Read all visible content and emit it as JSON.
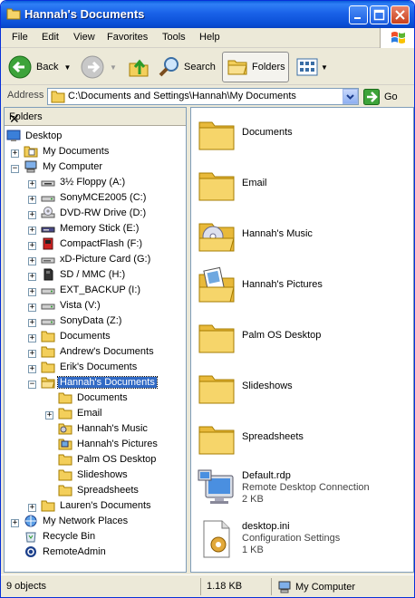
{
  "window": {
    "title": "Hannah's Documents"
  },
  "menubar": [
    "File",
    "Edit",
    "View",
    "Favorites",
    "Tools",
    "Help"
  ],
  "toolbar": {
    "back": "Back",
    "search": "Search",
    "folders": "Folders"
  },
  "address": {
    "label": "Address",
    "value": "C:\\Documents and Settings\\Hannah\\My Documents",
    "go": "Go"
  },
  "folders_pane": {
    "title": "Folders",
    "close": "✕"
  },
  "tree": [
    {
      "label": "Desktop"
    },
    {
      "label": "My Documents"
    },
    {
      "label": "My Computer"
    },
    {
      "label": "3½ Floppy (A:)"
    },
    {
      "label": "SonyMCE2005 (C:)"
    },
    {
      "label": "DVD-RW Drive (D:)"
    },
    {
      "label": "Memory Stick (E:)"
    },
    {
      "label": "CompactFlash (F:)"
    },
    {
      "label": "xD-Picture Card (G:)"
    },
    {
      "label": "SD / MMC (H:)"
    },
    {
      "label": "EXT_BACKUP (I:)"
    },
    {
      "label": "Vista (V:)"
    },
    {
      "label": "SonyData (Z:)"
    },
    {
      "label": "Documents"
    },
    {
      "label": "Andrew's Documents"
    },
    {
      "label": "Erik's Documents"
    },
    {
      "label": "Hannah's Documents"
    },
    {
      "label": "Documents"
    },
    {
      "label": "Email"
    },
    {
      "label": "Hannah's Music"
    },
    {
      "label": "Hannah's Pictures"
    },
    {
      "label": "Palm OS Desktop"
    },
    {
      "label": "Slideshows"
    },
    {
      "label": "Spreadsheets"
    },
    {
      "label": "Lauren's Documents"
    },
    {
      "label": "My Network Places"
    },
    {
      "label": "Recycle Bin"
    },
    {
      "label": "RemoteAdmin"
    }
  ],
  "content": [
    {
      "name": "Documents"
    },
    {
      "name": "Email"
    },
    {
      "name": "Hannah's Music"
    },
    {
      "name": "Hannah's Pictures"
    },
    {
      "name": "Palm OS Desktop"
    },
    {
      "name": "Slideshows"
    },
    {
      "name": "Spreadsheets"
    },
    {
      "name": "Default.rdp",
      "type": "Remote Desktop Connection",
      "size": "2 KB"
    },
    {
      "name": "desktop.ini",
      "type": "Configuration Settings",
      "size": "1 KB"
    }
  ],
  "status": {
    "objects": "9 objects",
    "size": "1.18 KB",
    "location": "My Computer"
  },
  "colors": {
    "title_blue": "#0a4fd6",
    "selection": "#316ac5",
    "folder_yellow": "#f3cf5b"
  }
}
